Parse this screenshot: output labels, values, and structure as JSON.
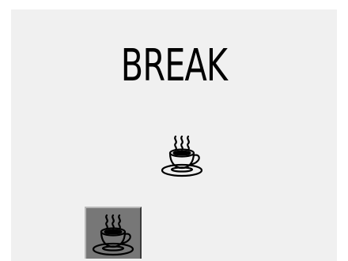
{
  "screen": {
    "title": "BREAK",
    "center_icon": "coffee-cup-icon",
    "button_icon": "coffee-cup-icon",
    "colors": {
      "panel_background": "#f0f0f0",
      "button_background": "#777777",
      "text": "#000000"
    }
  }
}
